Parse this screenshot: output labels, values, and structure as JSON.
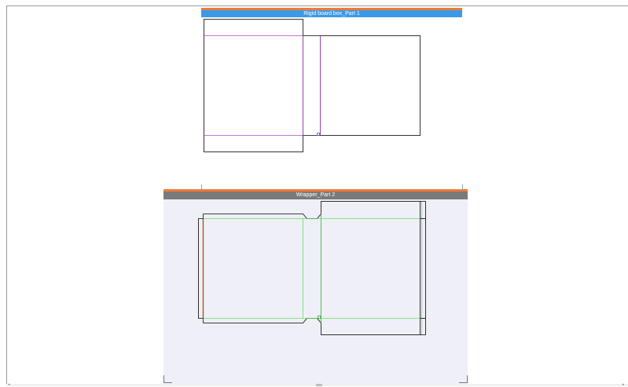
{
  "parts": [
    {
      "title": "Rigid board box_Part 1"
    },
    {
      "title": "Wrapper_Part 2"
    }
  ],
  "colors": {
    "accent_orange": "#f07a36",
    "part1_title_bar": "#3c99e6",
    "part2_title_bar": "#7a7a7a",
    "part2_background": "#efeff8",
    "cut_line": "#000000",
    "part1_fold_line": "#b04ac8",
    "part2_fold_line": "#5fe05f",
    "glue_edge": "#b4541a"
  }
}
